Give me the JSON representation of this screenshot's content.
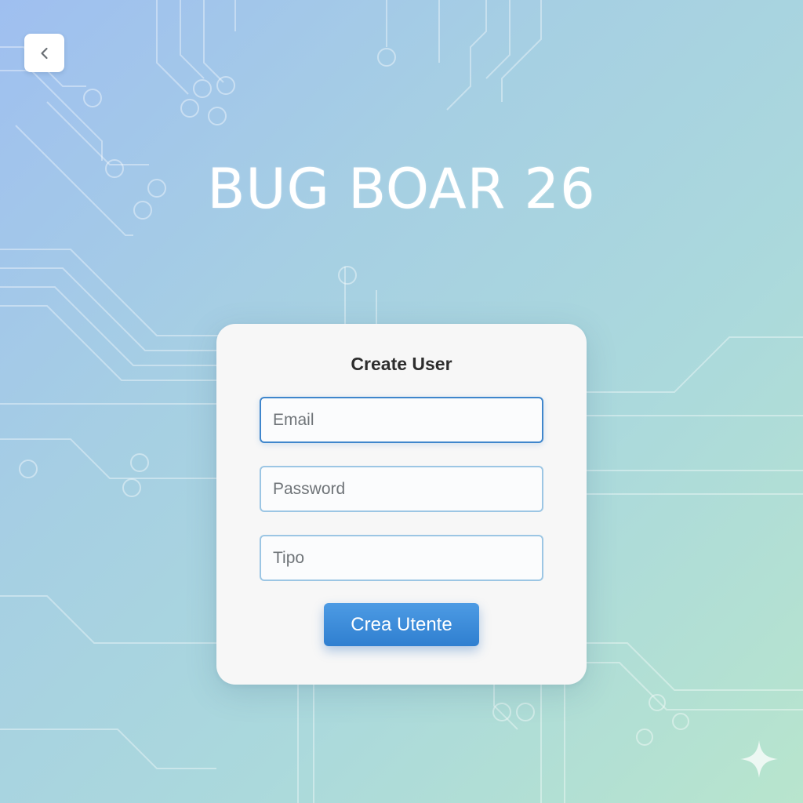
{
  "header": {
    "back_icon": "chevron-left-icon",
    "app_title": "BUG BOAR 26"
  },
  "form": {
    "title": "Create User",
    "fields": [
      {
        "name": "email",
        "value": "",
        "placeholder": "Email"
      },
      {
        "name": "password",
        "value": "",
        "placeholder": "Password"
      },
      {
        "name": "tipo",
        "value": "",
        "placeholder": "Tipo"
      }
    ],
    "submit_label": "Crea Utente"
  },
  "decoration": {
    "watermark_icon": "sparkle-icon"
  },
  "colors": {
    "accent": "#3a8ad8",
    "background_start": "#9fbff0",
    "background_end": "#b8e5cd",
    "card": "#f7f7f7"
  }
}
